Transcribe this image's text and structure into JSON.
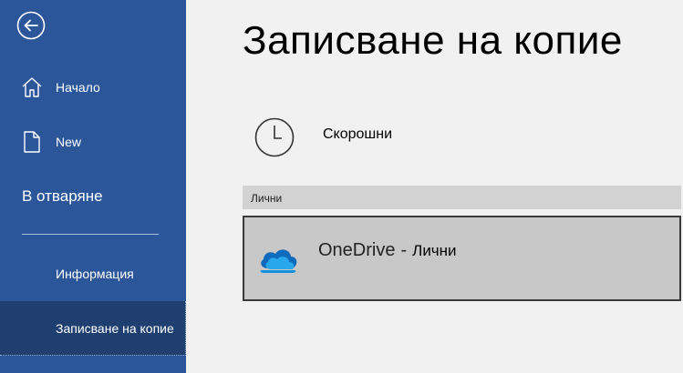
{
  "sidebar": {
    "back": {
      "icon": "back-arrow-icon"
    },
    "items": [
      {
        "label": "Начало",
        "icon": "home-icon"
      },
      {
        "label": "New",
        "icon": "new-document-icon"
      },
      {
        "label": "В отваряне"
      },
      {
        "label": "Информация"
      },
      {
        "label": "Записване на копие",
        "selected": true
      }
    ],
    "colors": {
      "background": "#2b579a",
      "selected": "#1e3f6f"
    }
  },
  "main": {
    "title": "Записване на копие",
    "recent": {
      "label": "Скорошни",
      "icon": "clock-icon"
    },
    "section": {
      "label": "Лични"
    },
    "locations": [
      {
        "name": "OneDrive",
        "separator": "-",
        "account": "Лични",
        "icon": "onedrive-cloud-icon"
      }
    ]
  }
}
